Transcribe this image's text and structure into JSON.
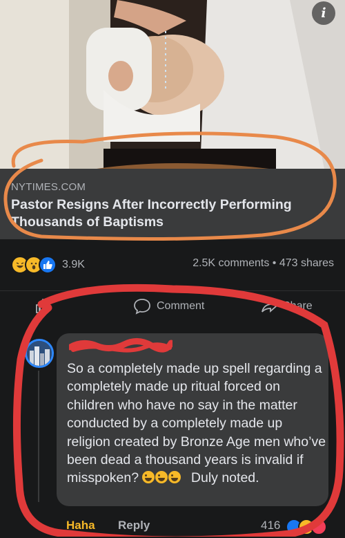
{
  "info_button": {
    "glyph": "i"
  },
  "link_preview": {
    "domain": "NYTIMES.COM",
    "headline": "Pastor Resigns After Incorrectly Performing Thousands of Baptisms"
  },
  "post_stats": {
    "reaction_icons": [
      "haha",
      "wow",
      "like"
    ],
    "reaction_count": "3.9K",
    "comments_shares": "2.5K comments • 473 shares"
  },
  "actions": {
    "comment_label": "Comment",
    "share_label": "Share"
  },
  "comment": {
    "text": "So a completely made up spell regarding a completely made up ritual forced on children who have no say in the matter conducted by a completely made up religion created by Bronze Age men who’ve been dead a thousand years is invalid if misspoken?",
    "tail": "Duly noted.",
    "haha_label": "Haha",
    "reply_label": "Reply",
    "reaction_count": "416"
  },
  "colors": {
    "background": "#18191a",
    "card": "#3a3b3c",
    "accent_blue": "#1877f2",
    "haha_yellow": "#f7b928",
    "annotation_orange": "#e8894a",
    "annotation_red": "#e03a3a"
  }
}
